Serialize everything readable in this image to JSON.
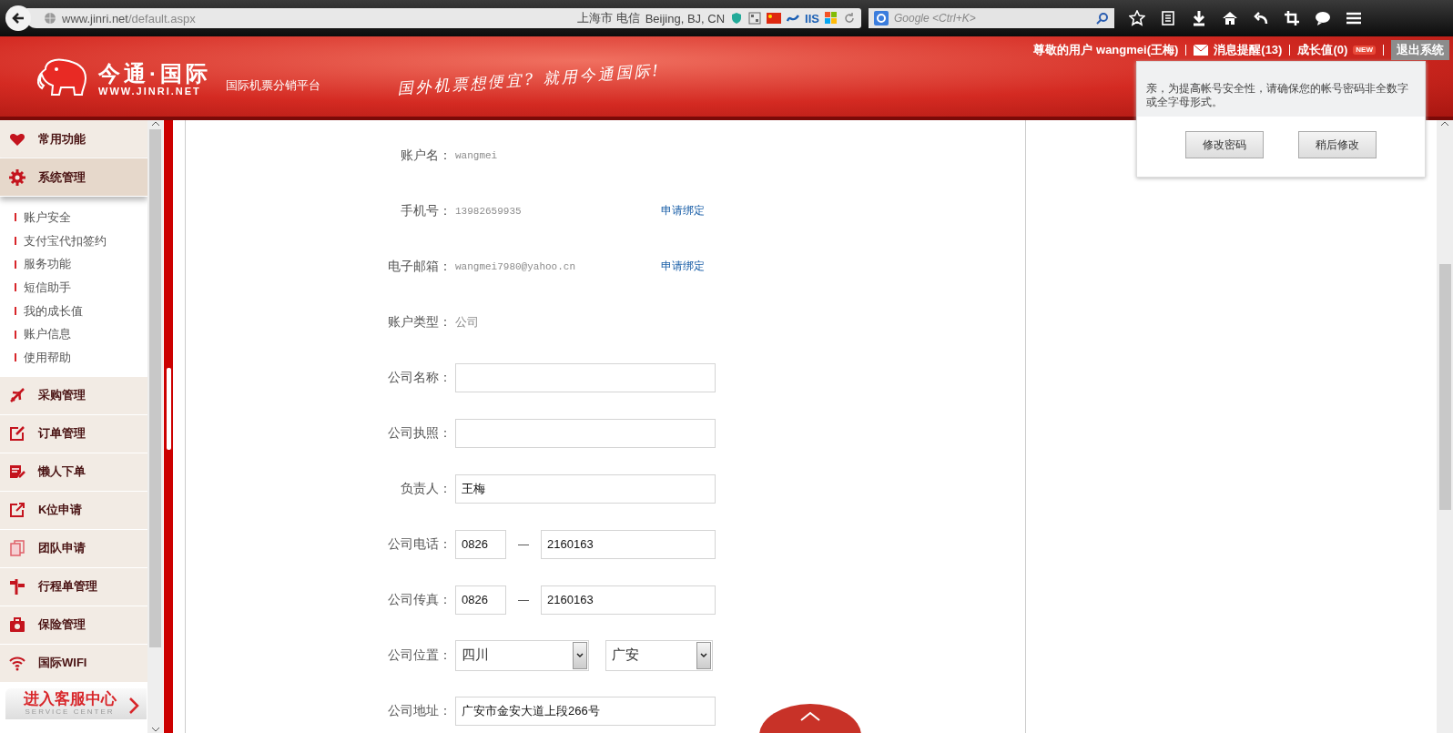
{
  "browser": {
    "url_host": "www.jinri.net",
    "url_path": "/default.aspx",
    "location_isp": "上海市 电信",
    "location_city": "Beijing, BJ, CN",
    "iis_label": "IIS",
    "search_placeholder": "Google <Ctrl+K>"
  },
  "header": {
    "logo_cn": "今通·国际",
    "logo_en": "WWW.JINRI.NET",
    "tagline": "国际机票分销平台",
    "slogan": "国外机票想便宜? 就用今通国际!",
    "user_bar": {
      "greeting": "尊敬的用户 wangmei(王梅)",
      "messages": "消息提醒(13)",
      "growth": "成长值(0)",
      "badge": "NEW",
      "logout": "退出系统"
    }
  },
  "sidebar": {
    "sections": [
      {
        "label": "常用功能",
        "expanded": false
      },
      {
        "label": "系统管理",
        "expanded": true,
        "children": [
          {
            "label": "账户安全"
          },
          {
            "label": "支付宝代扣签约"
          },
          {
            "label": "服务功能"
          },
          {
            "label": "短信助手"
          },
          {
            "label": "我的成长值"
          },
          {
            "label": "账户信息"
          },
          {
            "label": "使用帮助"
          }
        ]
      },
      {
        "label": "采购管理",
        "expanded": false
      },
      {
        "label": "订单管理",
        "expanded": false
      },
      {
        "label": "懒人下单",
        "expanded": false
      },
      {
        "label": "K位申请",
        "expanded": false
      },
      {
        "label": "团队申请",
        "expanded": false
      },
      {
        "label": "行程单管理",
        "expanded": false
      },
      {
        "label": "保险管理",
        "expanded": false
      },
      {
        "label": "国际WIFI",
        "expanded": false
      }
    ],
    "service_center": {
      "title": "进入客服中心",
      "subtitle": "SERVICE CENTER"
    }
  },
  "form": {
    "rows": [
      {
        "kind": "text",
        "label": "账户名：",
        "value": "wangmei"
      },
      {
        "kind": "text",
        "label": "手机号：",
        "value": "13982659935",
        "link": "申请绑定"
      },
      {
        "kind": "text",
        "label": "电子邮箱：",
        "value": "wangmei7980@yahoo.cn",
        "link": "申请绑定"
      },
      {
        "kind": "text",
        "label": "账户类型：",
        "value": "公司"
      },
      {
        "kind": "input",
        "label": "公司名称：",
        "value": ""
      },
      {
        "kind": "input",
        "label": "公司执照：",
        "value": ""
      },
      {
        "kind": "input",
        "label": "负责人：",
        "value": "王梅"
      },
      {
        "kind": "pair",
        "label": "公司电话：",
        "value": "0826",
        "separator": "—",
        "value_2": "2160163"
      },
      {
        "kind": "pair",
        "label": "公司传真：",
        "value": "0826",
        "separator": "—",
        "value_2": "2160163"
      },
      {
        "kind": "select",
        "label": "公司位置：",
        "value": "四川",
        "value_2": "广安"
      },
      {
        "kind": "input",
        "label": "公司地址：",
        "value": "广安市金安大道上段266号"
      }
    ]
  },
  "popup": {
    "message": "亲，为提高帐号安全性，请确保您的帐号密码非全数字或全字母形式。",
    "buttons": [
      "修改密码",
      "稍后修改"
    ]
  }
}
